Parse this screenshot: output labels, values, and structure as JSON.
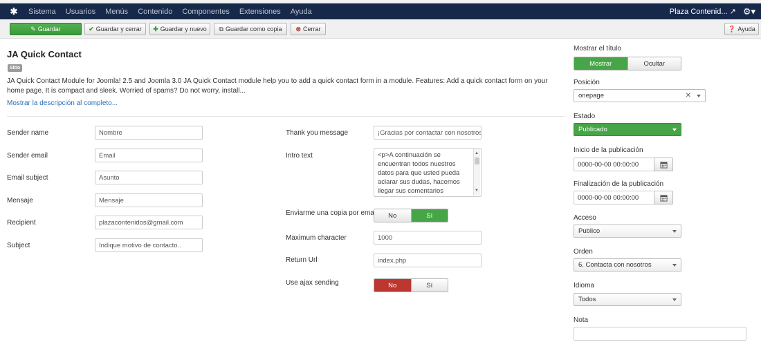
{
  "topbar": {
    "menu": [
      "Sistema",
      "Usuarios",
      "Menús",
      "Contenido",
      "Componentes",
      "Extensiones",
      "Ayuda"
    ],
    "site_name": "Plaza Contenid..."
  },
  "toolbar": {
    "save": "Guardar",
    "save_close": "Guardar y cerrar",
    "save_new": "Guardar y nuevo",
    "save_copy": "Guardar como copia",
    "close": "Cerrar",
    "help": "Ayuda"
  },
  "module": {
    "title": "JA Quick Contact",
    "badge": "Sitio",
    "description": "JA Quick Contact Module for Joomla! 2.5 and Joomla 3.0 JA Quick Contact module help you to add a quick contact form in a module. Features: Add a quick contact form on your home page. It is compact and sleek. Worried of spams? Do not worry, install...",
    "more_link": "Mostrar la descripción al completo..."
  },
  "left_fields": [
    {
      "label": "Sender name",
      "value": "Nombre"
    },
    {
      "label": "Sender email",
      "value": "Email"
    },
    {
      "label": "Email subject",
      "value": "Asunto"
    },
    {
      "label": "Mensaje",
      "value": "Mensaje"
    },
    {
      "label": "Recipient",
      "value": "plazacontenidos@gmail.com"
    },
    {
      "label": "Subject",
      "value": "Indique motivo de contacto.."
    }
  ],
  "middle_fields": {
    "thank_you": {
      "label": "Thank you message",
      "value": "¡Gracias por contactar con nosotros"
    },
    "intro": {
      "label": "Intro text",
      "value": "<p>A continuación se encuentran todos nuestros datos para que usted pueda aclarar sus dudas, hacemos llegar sus comentarios"
    },
    "copy_email": {
      "label": "Enviarme una copia por email",
      "no": "No",
      "yes": "Sí",
      "selected": "Sí"
    },
    "max_char": {
      "label": "Maximum character",
      "value": "1000"
    },
    "return_url": {
      "label": "Return Url",
      "value": "index.php"
    },
    "ajax": {
      "label": "Use ajax sending",
      "no": "No",
      "yes": "Sí",
      "selected": "No"
    }
  },
  "sidebar": {
    "show_title": {
      "label": "Mostrar el título",
      "on": "Mostrar",
      "off": "Ocultar",
      "selected": "Mostrar"
    },
    "position": {
      "label": "Posición",
      "value": "onepage"
    },
    "state": {
      "label": "Estado",
      "value": "Publicado"
    },
    "publish_start": {
      "label": "Inicio de la publicación",
      "value": "0000-00-00 00:00:00"
    },
    "publish_end": {
      "label": "Finalización de la publicación",
      "value": "0000-00-00 00:00:00"
    },
    "access": {
      "label": "Acceso",
      "value": "Publico"
    },
    "order": {
      "label": "Orden",
      "value": "6. Contacta con nosotros"
    },
    "language": {
      "label": "Idioma",
      "value": "Todos"
    },
    "note": {
      "label": "Nota",
      "value": ""
    }
  },
  "colors": {
    "topbar": "#17294a",
    "primary": "#46a546",
    "danger": "#bd362f",
    "link": "#2a6ebb"
  }
}
